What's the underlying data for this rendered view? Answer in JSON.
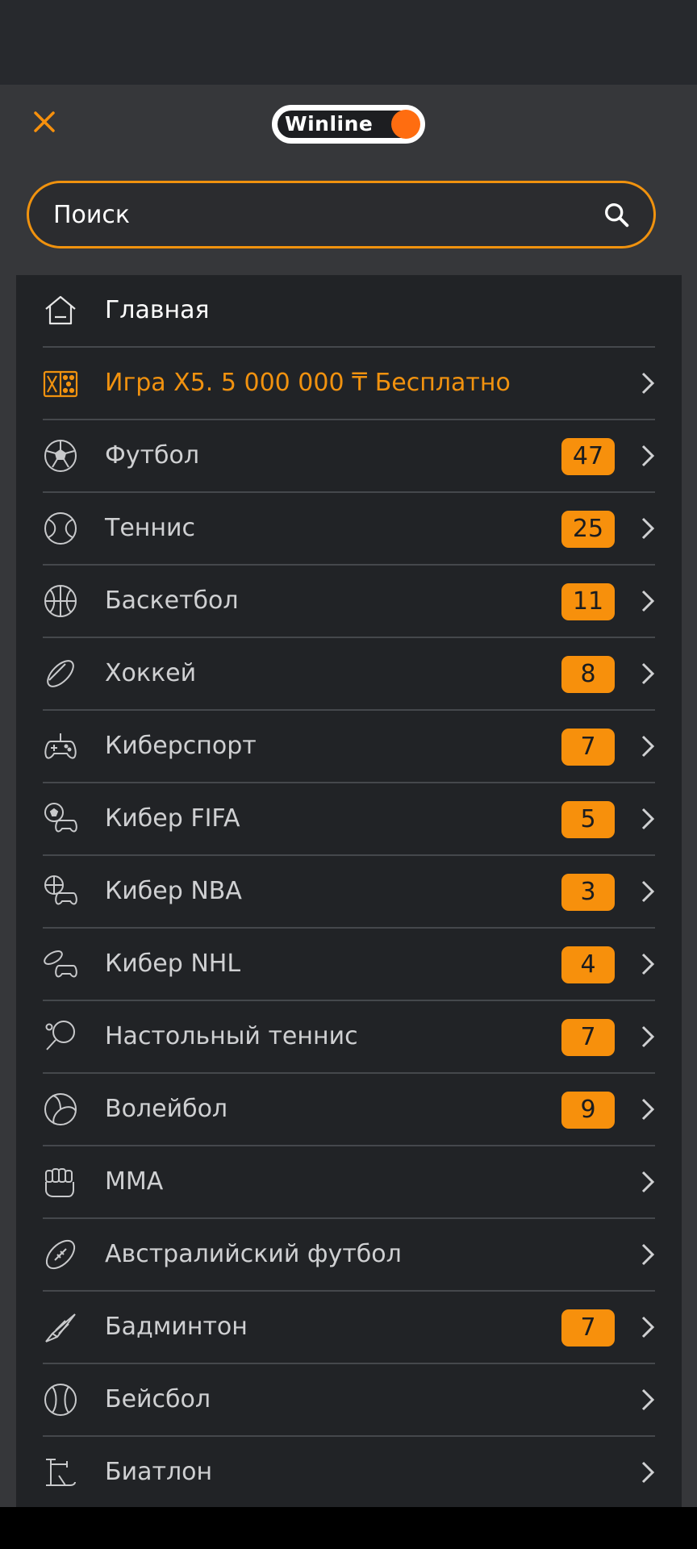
{
  "header": {
    "logo_text": "Winline",
    "close_icon": "close-icon",
    "accent_color": "#f7900c",
    "logo_dot_color": "#ff6d10"
  },
  "search": {
    "placeholder": "Поиск",
    "value": "",
    "icon": "search-icon"
  },
  "menu": {
    "items": [
      {
        "label": "Главная",
        "icon": "home-icon",
        "count": "",
        "chevron": false
      },
      {
        "label": "Игра X5. 5 000 000 ₸ Бесплатно",
        "icon": "dice-x5-icon",
        "count": "",
        "chevron": true
      },
      {
        "label": "Футбол",
        "icon": "soccer-ball-icon",
        "count": "47",
        "chevron": true
      },
      {
        "label": "Теннис",
        "icon": "tennis-ball-icon",
        "count": "25",
        "chevron": true
      },
      {
        "label": "Баскетбол",
        "icon": "basketball-icon",
        "count": "11",
        "chevron": true
      },
      {
        "label": "Хоккей",
        "icon": "hockey-puck-icon",
        "count": "8",
        "chevron": true
      },
      {
        "label": "Киберспорт",
        "icon": "gamepad-icon",
        "count": "7",
        "chevron": true
      },
      {
        "label": "Кибер FIFA",
        "icon": "cyber-fifa-icon",
        "count": "5",
        "chevron": true
      },
      {
        "label": "Кибер NBA",
        "icon": "cyber-nba-icon",
        "count": "3",
        "chevron": true
      },
      {
        "label": "Кибер NHL",
        "icon": "cyber-nhl-icon",
        "count": "4",
        "chevron": true
      },
      {
        "label": "Настольный теннис",
        "icon": "table-tennis-icon",
        "count": "7",
        "chevron": true
      },
      {
        "label": "Волейбол",
        "icon": "volleyball-icon",
        "count": "9",
        "chevron": true
      },
      {
        "label": "ММА",
        "icon": "mma-fist-icon",
        "count": "",
        "chevron": true
      },
      {
        "label": "Австралийский футбол",
        "icon": "australian-football-icon",
        "count": "",
        "chevron": true
      },
      {
        "label": "Бадминтон",
        "icon": "shuttlecock-icon",
        "count": "7",
        "chevron": true
      },
      {
        "label": "Бейсбол",
        "icon": "baseball-icon",
        "count": "",
        "chevron": true
      },
      {
        "label": "Биатлон",
        "icon": "biathlon-icon",
        "count": "",
        "chevron": true
      },
      {
        "label": "",
        "icon": "next-sport-icon",
        "count": "",
        "chevron": true
      }
    ]
  }
}
